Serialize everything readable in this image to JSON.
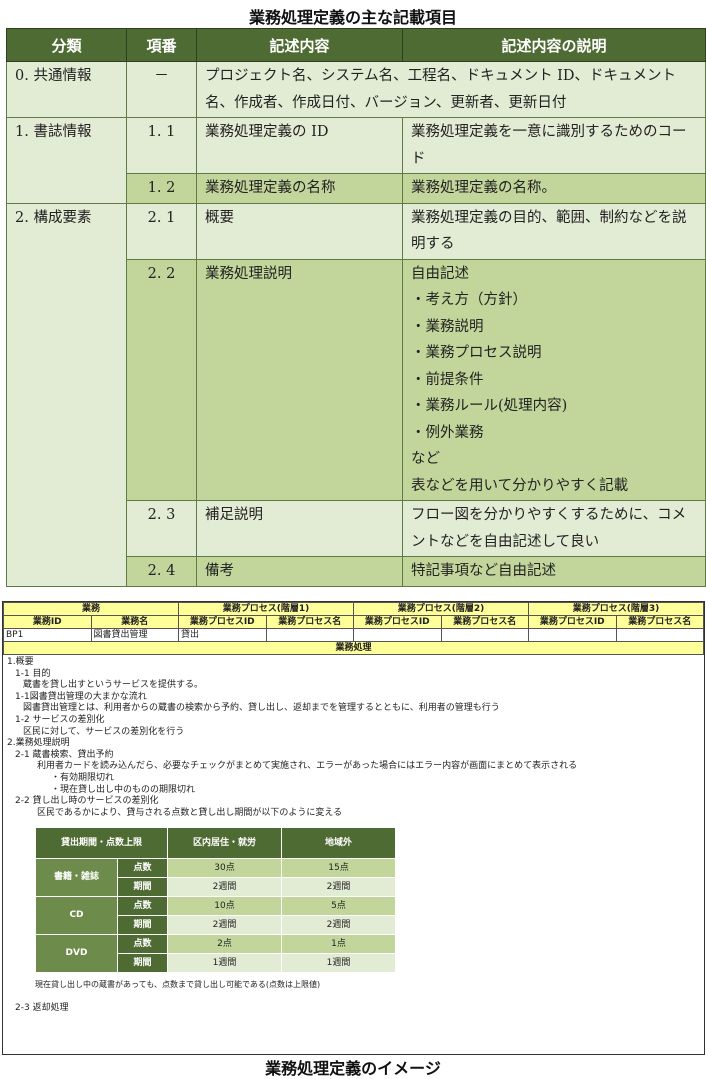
{
  "top_title": "業務処理定義の主な記載項目",
  "bottom_title": "業務処理定義のイメージ",
  "main_table": {
    "headers": [
      "分類",
      "項番",
      "記述内容",
      "記述内容の説明"
    ],
    "r0": {
      "cat": "0. 共通情報",
      "num": "－",
      "text": "プロジェクト名、システム名、工程名、ドキュメント ID、ドキュメント名、作成者、作成日付、バージョン、更新者、更新日付"
    },
    "cat1": "1. 書誌情報",
    "r11": {
      "num": "1. 1",
      "content": "業務処理定義の ID",
      "desc": "業務処理定義を一意に識別するためのコード"
    },
    "r12": {
      "num": "1. 2",
      "content": "業務処理定義の名称",
      "desc": "業務処理定義の名称。"
    },
    "cat2": "2. 構成要素",
    "r21": {
      "num": "2. 1",
      "content": "概要",
      "desc": "業務処理定義の目的、範囲、制約などを説明する"
    },
    "r22": {
      "num": "2. 2",
      "content": "業務処理説明",
      "desc": [
        "自由記述",
        "・考え方（方針）",
        "・業務説明",
        "・業務プロセス説明",
        "・前提条件",
        "・業務ルール(処理内容)",
        "・例外業務",
        "など",
        "表などを用いて分かりやすく記載"
      ]
    },
    "r23": {
      "num": "2. 3",
      "content": "補足説明",
      "desc": "フロー図を分かりやすくするために、コメントなどを自由記述して良い"
    },
    "r24": {
      "num": "2. 4",
      "content": "備考",
      "desc": "特記事項など自由記述"
    }
  },
  "figure": {
    "header_groups": [
      "業務",
      "業務プロセス(階層1)",
      "業務プロセス(階層2)",
      "業務プロセス(階層3)"
    ],
    "header_cols": [
      "業務ID",
      "業務名",
      "業務プロセスID",
      "業務プロセス名",
      "業務プロセスID",
      "業務プロセス名",
      "業務プロセスID",
      "業務プロセス名"
    ],
    "row": [
      "BP1",
      "図書貸出管理",
      "貸出",
      "",
      "",
      "",
      "",
      ""
    ],
    "section_label": "業務処理",
    "lines1": [
      {
        "t": "1.概要",
        "c": "i0"
      },
      {
        "t": "1-1  目的",
        "c": "i1"
      },
      {
        "t": "蔵書を貸し出すというサービスを提供する。",
        "c": "i2"
      },
      {
        "t": "1-1図書貸出管理の大まかな流れ",
        "c": "i1"
      },
      {
        "t": "図書貸出管理とは、利用者からの蔵書の検索から予約、貸し出し、返却までを管理するとともに、利用者の管理も行う",
        "c": "i2"
      },
      {
        "t": "1-2  サービスの差別化",
        "c": "i1"
      },
      {
        "t": "区民に対して、サービスの差別化を行う",
        "c": "i2"
      },
      {
        "t": " ",
        "c": "i0"
      },
      {
        "t": "2.業務処理説明",
        "c": "i0"
      },
      {
        "t": "2-1 蔵書検索、貸出予約",
        "c": "i1"
      },
      {
        "t": "利用者カードを読み込んだら、必要なチェックがまとめて実施され、エラーがあった場合にはエラー内容が画面にまとめて表示される",
        "c": "i3"
      },
      {
        "t": "・有効期限切れ",
        "c": "i4"
      },
      {
        "t": "・現在貸し出し中のものの期限切れ",
        "c": "i4"
      },
      {
        "t": " ",
        "c": "i0"
      },
      {
        "t": "2-2 貸し出し時のサービスの差別化",
        "c": "i1"
      },
      {
        "t": "区民であるかにより、貸与される点数と貸し出し期間が以下のように変える",
        "c": "i3"
      }
    ],
    "inner_table": {
      "headers": [
        "貸出期間・点数上限",
        "区内居住・就労",
        "地域外"
      ],
      "groups": [
        {
          "name": "書籍・雑誌",
          "rows": [
            [
              "点数",
              "30点",
              "15点"
            ],
            [
              "期間",
              "2週間",
              "2週間"
            ]
          ]
        },
        {
          "name": "CD",
          "rows": [
            [
              "点数",
              "10点",
              "5点"
            ],
            [
              "期間",
              "2週間",
              "2週間"
            ]
          ]
        },
        {
          "name": "DVD",
          "rows": [
            [
              "点数",
              "2点",
              "1点"
            ],
            [
              "期間",
              "1週間",
              "1週間"
            ]
          ]
        }
      ]
    },
    "note": "現在貸し出し中の蔵書があっても、点数まで貸し出し可能である(点数は上限値)",
    "last_line": "2-3  返却処理"
  }
}
